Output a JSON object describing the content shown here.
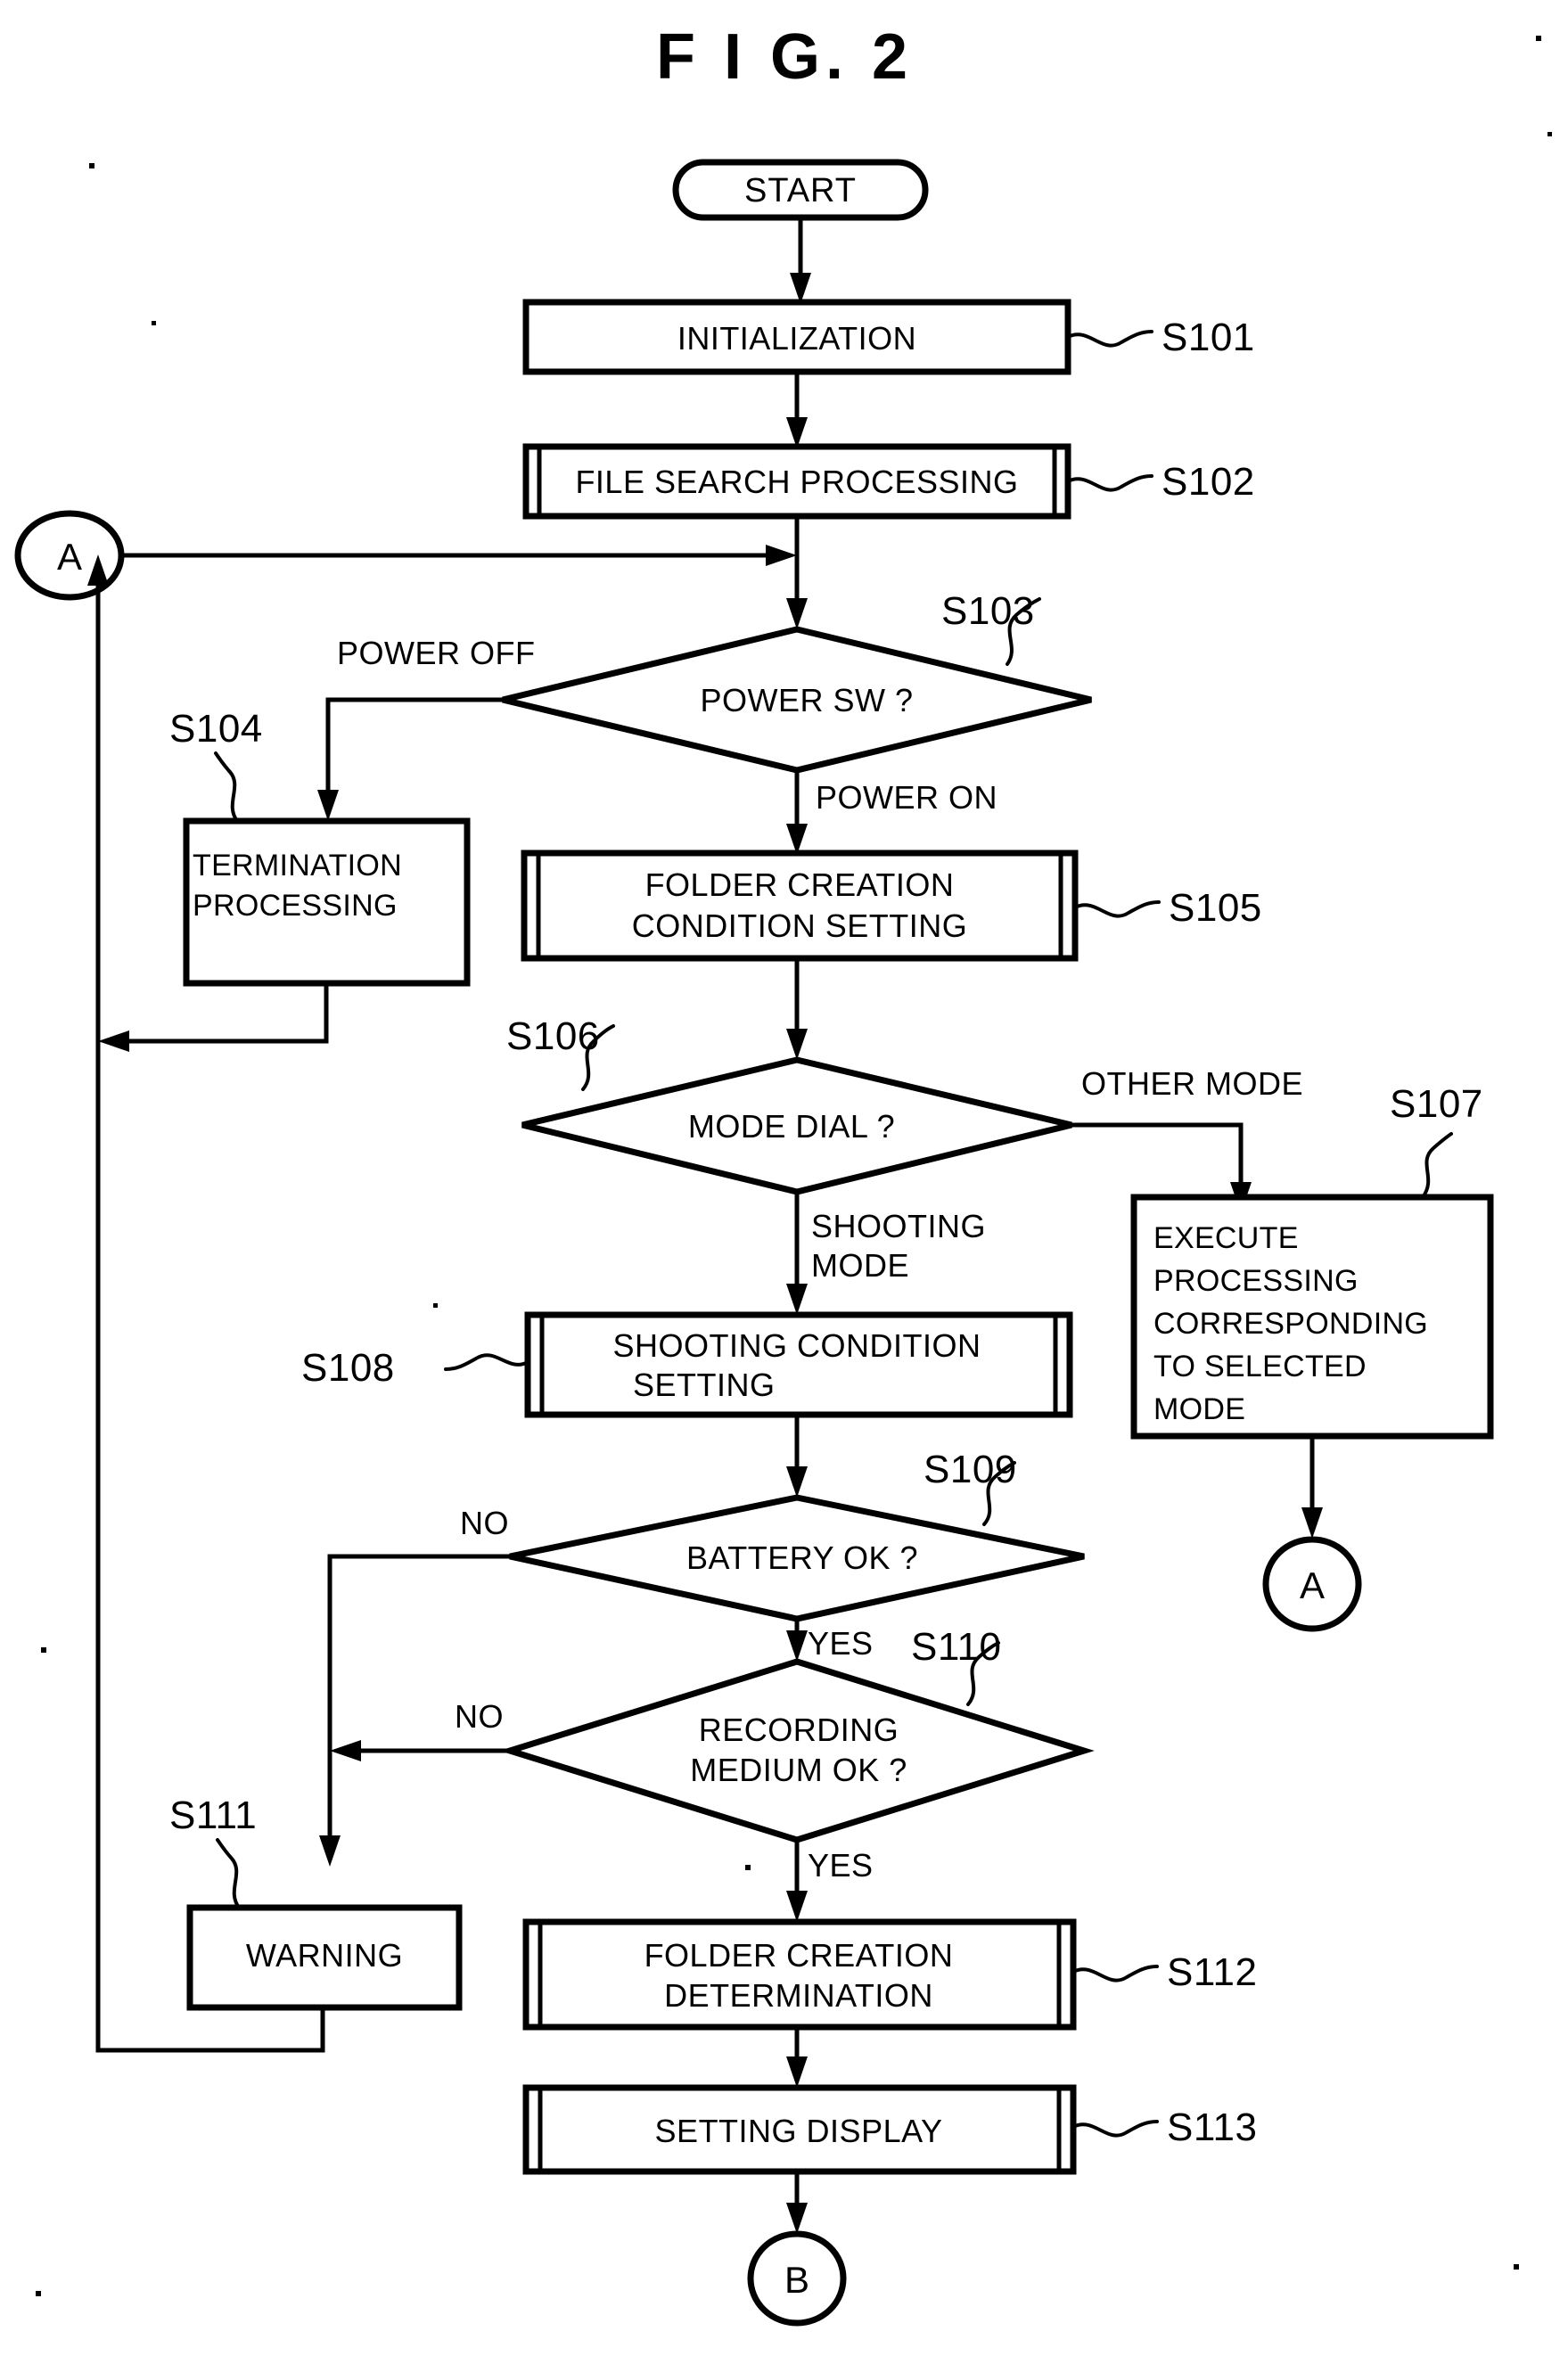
{
  "figure": {
    "title": "F I G.  2",
    "title_plain": "FIG. 2"
  },
  "nodes": {
    "start": {
      "label": "START",
      "shape": "terminator"
    },
    "s101": {
      "label": "INITIALIZATION",
      "step": "S101",
      "shape": "process"
    },
    "s102": {
      "label": "FILE SEARCH PROCESSING",
      "step": "S102",
      "shape": "subroutine"
    },
    "s103": {
      "label": "POWER SW ?",
      "step": "S103",
      "shape": "decision"
    },
    "s104": {
      "label_line1": "TERMINATION",
      "label_line2": "PROCESSING",
      "step": "S104",
      "shape": "process"
    },
    "s105": {
      "label_line1": "FOLDER CREATION",
      "label_line2": "CONDITION SETTING",
      "step": "S105",
      "shape": "subroutine"
    },
    "s106": {
      "label": "MODE DIAL ?",
      "step": "S106",
      "shape": "decision"
    },
    "s107": {
      "label_line1": "EXECUTE",
      "label_line2": "PROCESSING",
      "label_line3": "CORRESPONDING",
      "label_line4": "TO SELECTED",
      "label_line5": "MODE",
      "step": "S107",
      "shape": "process"
    },
    "s108": {
      "label_line1": "SHOOTING CONDITION",
      "label_line2": "SETTING",
      "step": "S108",
      "shape": "subroutine"
    },
    "s109": {
      "label": "BATTERY OK ?",
      "step": "S109",
      "shape": "decision"
    },
    "s110": {
      "label_line1": "RECORDING",
      "label_line2": "MEDIUM OK ?",
      "step": "S110",
      "shape": "decision"
    },
    "s111": {
      "label": "WARNING",
      "step": "S111",
      "shape": "process"
    },
    "s112": {
      "label_line1": "FOLDER CREATION",
      "label_line2": "DETERMINATION",
      "step": "S112",
      "shape": "subroutine"
    },
    "s113": {
      "label": "SETTING DISPLAY",
      "step": "S113",
      "shape": "subroutine"
    },
    "connector_a_left": {
      "label": "A",
      "shape": "connector"
    },
    "connector_a_right": {
      "label": "A",
      "shape": "connector"
    },
    "connector_b": {
      "label": "B",
      "shape": "connector"
    }
  },
  "edge_labels": {
    "power_off": "POWER OFF",
    "power_on": "POWER ON",
    "other_mode": "OTHER MODE",
    "shooting_mode_line1": "SHOOTING",
    "shooting_mode_line2": "MODE",
    "battery_no": "NO",
    "battery_yes": "YES",
    "medium_no": "NO",
    "medium_yes": "YES"
  },
  "colors": {
    "ink": "#000000",
    "paper": "#ffffff"
  }
}
